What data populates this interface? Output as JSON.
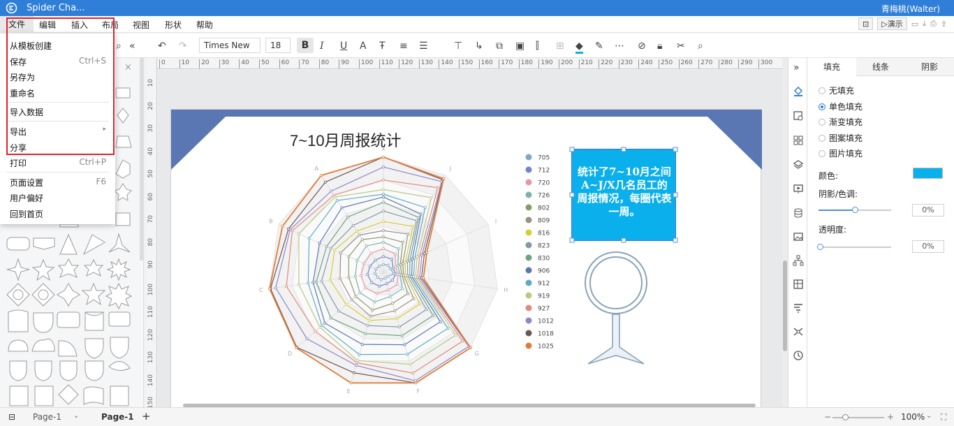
{
  "app": {
    "title": "Spider Cha...",
    "user": "青梅桃(Walter)"
  },
  "menu": {
    "items": [
      "文件",
      "编辑",
      "插入",
      "布局",
      "视图",
      "形状",
      "帮助"
    ],
    "present_label": "演示"
  },
  "toolbar": {
    "font_family": "Times New ...",
    "font_size": "18"
  },
  "file_menu": {
    "items": [
      {
        "label": "从模板创建",
        "shortcut": ""
      },
      {
        "label": "保存",
        "shortcut": "Ctrl+S"
      },
      {
        "label": "另存为",
        "shortcut": ""
      },
      {
        "label": "重命名",
        "shortcut": ""
      },
      {
        "label": "导入数据",
        "shortcut": ""
      },
      {
        "label": "导出",
        "shortcut": "▸"
      },
      {
        "label": "分享",
        "shortcut": ""
      },
      {
        "label": "打印",
        "shortcut": "Ctrl+P"
      },
      {
        "label": "页面设置",
        "shortcut": "F6"
      },
      {
        "label": "用户偏好",
        "shortcut": ""
      },
      {
        "label": "回到首页",
        "shortcut": ""
      }
    ]
  },
  "ruler": {
    "top": [
      "0",
      "10",
      "20",
      "30",
      "40",
      "50",
      "60",
      "70",
      "80",
      "90",
      "100",
      "110",
      "120",
      "130",
      "140",
      "150",
      "160",
      "170",
      "180",
      "190",
      "200",
      "210",
      "220",
      "230",
      "240",
      "250",
      "260",
      "270",
      "280",
      "290",
      "300"
    ],
    "left": [
      "10",
      "20",
      "30",
      "40",
      "50",
      "60",
      "70",
      "80",
      "90",
      "100",
      "110",
      "120",
      "130",
      "140",
      "150"
    ]
  },
  "diagram": {
    "title": "7~10月周报统计",
    "callout": "统计了7~10月之间A~J/X几名员工的周报情况，每圈代表一周。",
    "callout_color": "#0ab0ec",
    "banner_color": "#5a77b3"
  },
  "chart_data": {
    "type": "radar",
    "axes": [
      "X",
      "J",
      "I",
      "H",
      "G",
      "F",
      "E",
      "D",
      "C",
      "B",
      "A"
    ],
    "series": [
      {
        "name": "705",
        "color": "#7fa7c9"
      },
      {
        "name": "712",
        "color": "#6f86c8"
      },
      {
        "name": "720",
        "color": "#e39aa6"
      },
      {
        "name": "726",
        "color": "#7bb3a8"
      },
      {
        "name": "802",
        "color": "#8a9a6e"
      },
      {
        "name": "809",
        "color": "#9c8f86"
      },
      {
        "name": "816",
        "color": "#d7cc32"
      },
      {
        "name": "823",
        "color": "#8399a8"
      },
      {
        "name": "830",
        "color": "#6ea384"
      },
      {
        "name": "906",
        "color": "#5b75b5"
      },
      {
        "name": "912",
        "color": "#5eaac2"
      },
      {
        "name": "919",
        "color": "#b9c985"
      },
      {
        "name": "927",
        "color": "#e08a7f"
      },
      {
        "name": "1012",
        "color": "#8f86c9"
      },
      {
        "name": "1018",
        "color": "#6b5656"
      },
      {
        "name": "1025",
        "color": "#e17d3c"
      }
    ],
    "legend_position": "right"
  },
  "right_panel": {
    "tabs": [
      "填充",
      "线条",
      "阴影"
    ],
    "fill_options": [
      "无填充",
      "单色填充",
      "渐变填充",
      "图案填充",
      "图片填充"
    ],
    "selected_option": "单色填充",
    "color_label": "颜色:",
    "color_value": "#0ab0ec",
    "shade_label": "阴影/色调:",
    "shade_value": "0%",
    "transparency_label": "透明度:",
    "transparency_value": "0%"
  },
  "bottom": {
    "page_tab": "Page-1",
    "page_active": "Page-1",
    "zoom": "100%"
  }
}
